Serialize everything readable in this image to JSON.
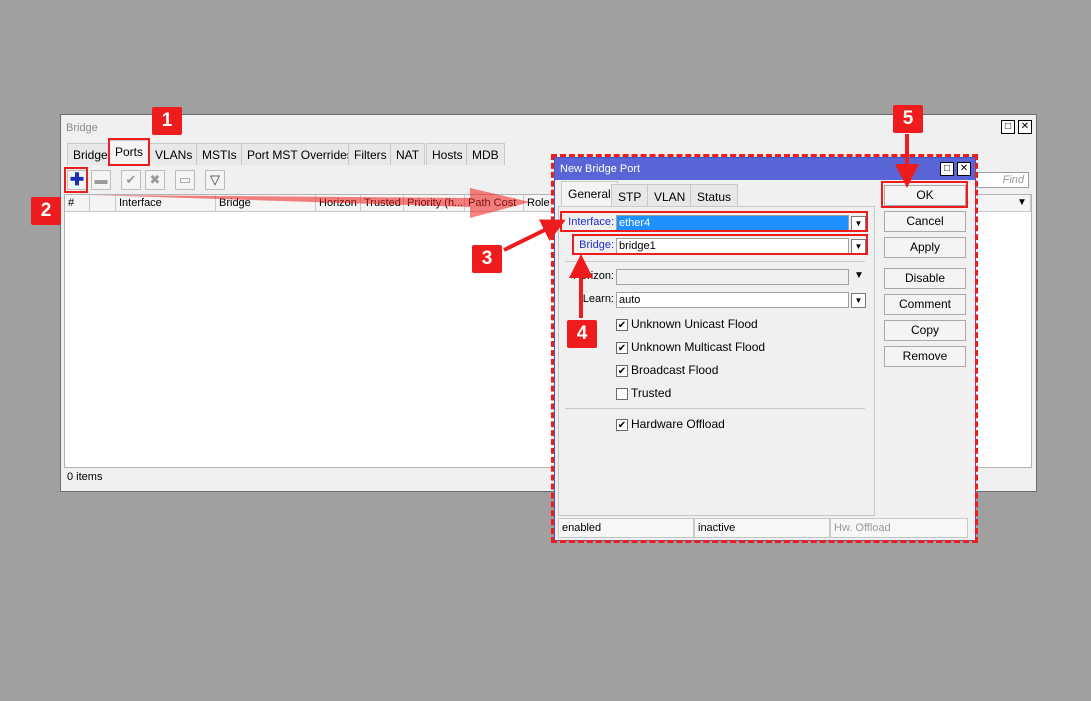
{
  "bridge_window": {
    "title": "Bridge",
    "tabs": [
      "Bridge",
      "Ports",
      "VLANs",
      "MSTIs",
      "Port MST Overrides",
      "Filters",
      "NAT",
      "Hosts",
      "MDB"
    ],
    "find_placeholder": "Find",
    "columns": [
      "#",
      "",
      "Interface",
      "Bridge",
      "Horizon",
      "Trusted",
      "Priority (h...",
      "Path Cost",
      "Role"
    ],
    "items_count": "0 items",
    "toolbar_icons": [
      "add-icon",
      "remove-icon",
      "enable-icon",
      "disable-icon",
      "comment-icon",
      "filter-icon"
    ]
  },
  "dialog": {
    "title": "New Bridge Port",
    "tabs": [
      "General",
      "STP",
      "VLAN",
      "Status"
    ],
    "interface": {
      "label": "Interface:",
      "value": "ether4"
    },
    "bridge": {
      "label": "Bridge:",
      "value": "bridge1"
    },
    "horizon": {
      "label": "Horizon:",
      "value": ""
    },
    "learn": {
      "label": "Learn:",
      "value": "auto"
    },
    "checks": [
      {
        "label": "Unknown Unicast Flood",
        "checked": true
      },
      {
        "label": "Unknown Multicast Flood",
        "checked": true
      },
      {
        "label": "Broadcast Flood",
        "checked": true
      },
      {
        "label": "Trusted",
        "checked": false
      }
    ],
    "hw_offload": {
      "label": "Hardware Offload",
      "checked": true
    },
    "buttons": {
      "ok": "OK",
      "cancel": "Cancel",
      "apply": "Apply",
      "disable": "Disable",
      "comment": "Comment",
      "copy": "Copy",
      "remove": "Remove"
    },
    "status": {
      "state": "enabled",
      "activity": "inactive",
      "hw": "Hw. Offload"
    }
  },
  "annotations": {
    "n1": "1",
    "n2": "2",
    "n3": "3",
    "n4": "4",
    "n5": "5"
  },
  "colors": {
    "highlight": "#ee1c1c",
    "dialog_title": "#5965d6",
    "selection": "#1e90ff"
  }
}
